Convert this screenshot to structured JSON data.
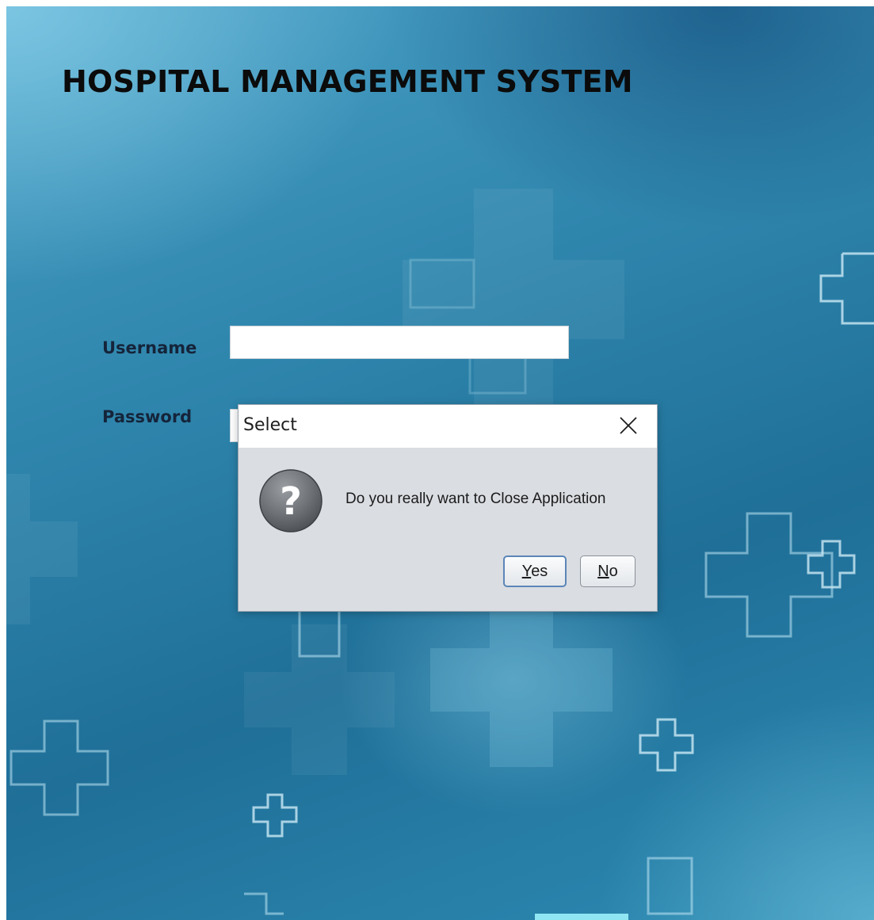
{
  "app": {
    "title": "HOSPITAL MANAGEMENT SYSTEM"
  },
  "login": {
    "username_label": "Username",
    "password_label": "Password",
    "username_value": "",
    "password_value": ""
  },
  "dialog": {
    "title": "Select",
    "message": "Do you really want to Close Application",
    "icon": "question-icon",
    "close_icon": "close-icon",
    "yes_label": "Yes",
    "yes_mnemonic": "Y",
    "yes_rest": "es",
    "no_label": "No",
    "no_mnemonic": "N",
    "no_rest": "o"
  },
  "colors": {
    "background_primary": "#2f86ad",
    "background_light": "#8cd2eb",
    "title_text": "#0b0b0b",
    "dialog_body": "#dadde2",
    "default_button_border": "#5b86b8"
  }
}
